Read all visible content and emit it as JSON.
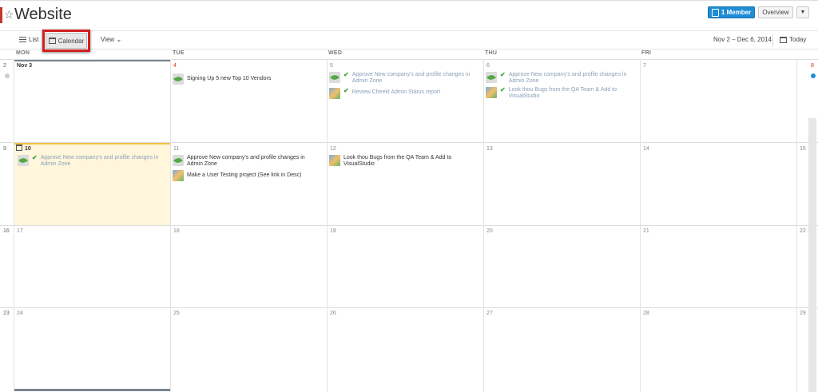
{
  "header": {
    "title": "Website",
    "star_icon": "star-icon",
    "member_button": "1 Member",
    "overview_button": "Overview",
    "more_icon": "chevron-down-icon"
  },
  "toolbar": {
    "list_label": "List",
    "calendar_label": "Calendar",
    "view_label": "View",
    "date_range": "Nov 2 – Dec 6, 2014",
    "today_label": "Today"
  },
  "days": [
    "MON",
    "TUE",
    "WED",
    "THU",
    "FRI"
  ],
  "weeks": [
    {
      "week": "2",
      "dates": [
        "Nov 3",
        "4",
        "5",
        "6",
        "7"
      ],
      "sat": "8"
    },
    {
      "week": "9",
      "dates": [
        "10",
        "11",
        "12",
        "13",
        "14"
      ],
      "sat": "15"
    },
    {
      "week": "16",
      "dates": [
        "17",
        "18",
        "19",
        "20",
        "21"
      ],
      "sat": "22"
    },
    {
      "week": "23",
      "dates": [
        "24",
        "25",
        "26",
        "27",
        "28"
      ],
      "sat": "29"
    }
  ],
  "tasks": {
    "tue4": "Signing Up 5 new Top 10 Vendors",
    "wed5_a": "Approve New company's and profile changes in Admin Zone",
    "wed5_b": "Review Cheekt Admin Status report",
    "thu6_a": "Approve New company's and profile changes in Admin Zone",
    "thu6_b": "Look thou Bugs from the QA Team & Add to VisualStudio",
    "mon10": "Approve New company's and profile changes in Admin Zone",
    "tue11_a": "Approve New company's and profile changes in Admin Zone",
    "tue11_b": "Make a User Testing project (See link in Desc)",
    "wed12": "Look thou Bugs from the QA Team & Add to VisualStudio"
  },
  "colors": {
    "accent_blue": "#1f8dd6",
    "highlight": "#d31f1f",
    "today_cell": "#fff6dc",
    "red_date": "#d62d20"
  }
}
